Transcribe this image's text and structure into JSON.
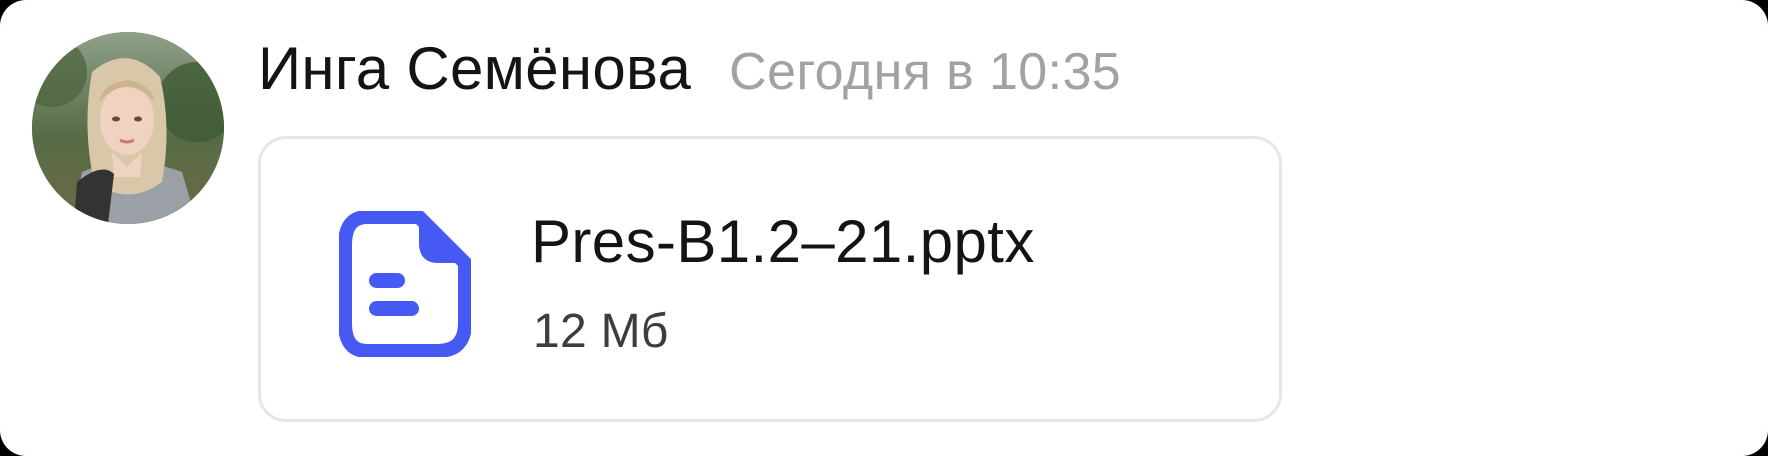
{
  "message": {
    "author": "Инга Семёнова",
    "time": "Сегодня в 10:35"
  },
  "attachment": {
    "file_name": "Pres-B1.2–21.pptx",
    "file_size": "12 Мб",
    "icon": "document-icon"
  },
  "colors": {
    "icon_accent": "#4659f2",
    "author_text": "#141414",
    "time_text": "#a2a2a2",
    "size_text": "#3d3d3d",
    "card_border": "#e6e6e6"
  }
}
